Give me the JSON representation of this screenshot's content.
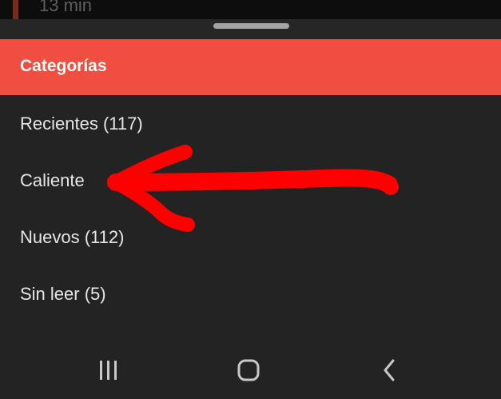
{
  "background_item": {
    "text": "13 min"
  },
  "header": {
    "title": "Categorías"
  },
  "categories": [
    {
      "label": "Recientes (117)"
    },
    {
      "label": "Caliente"
    },
    {
      "label": "Nuevos (112)"
    },
    {
      "label": "Sin leer (5)"
    }
  ],
  "annotation": {
    "color": "#ff0000",
    "points_to": "Caliente"
  },
  "nav_bar": {
    "icons": [
      "recent-apps-icon",
      "home-icon",
      "back-icon"
    ]
  },
  "colors": {
    "accent": "#f04e40",
    "background": "#232323",
    "text": "#e6e6e6"
  }
}
